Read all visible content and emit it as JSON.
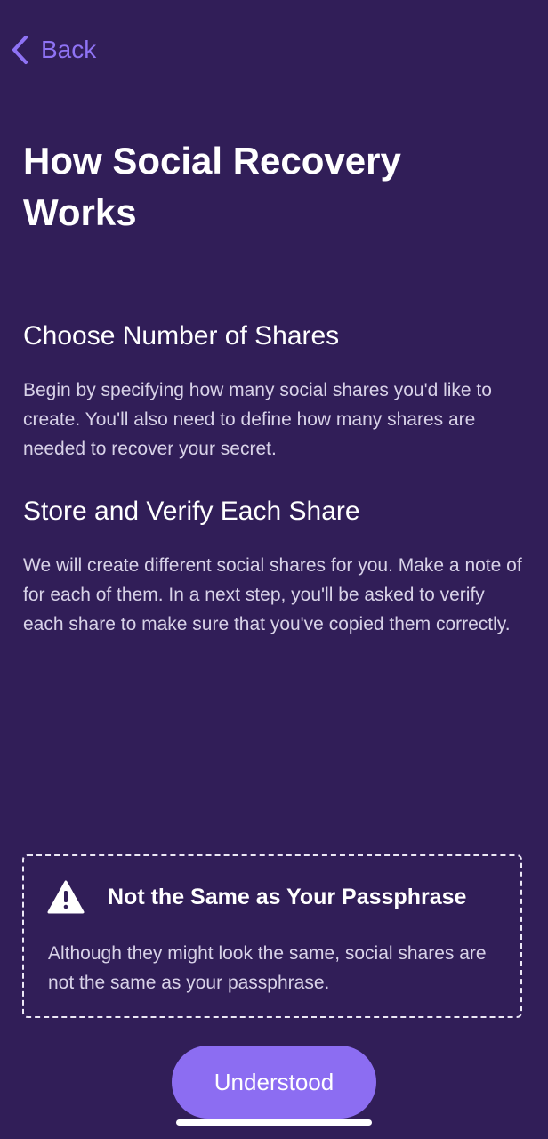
{
  "nav": {
    "back_label": "Back"
  },
  "page": {
    "title": "How Social Recovery Works"
  },
  "sections": [
    {
      "heading": "Choose Number of Shares",
      "body": "Begin by specifying how many social shares you'd like to create. You'll also need to define how many shares are needed to recover your secret."
    },
    {
      "heading": "Store and Verify Each Share",
      "body": "We will create different social shares for you. Make a note of for each of them. In a next step, you'll be asked to verify each share to make sure that you've copied them correctly."
    }
  ],
  "warning": {
    "icon": "warning-triangle-icon",
    "title": "Not the Same as Your Passphrase",
    "body": "Although they might look the same, social shares are not the same as your passphrase."
  },
  "actions": {
    "primary_label": "Understood"
  },
  "colors": {
    "background": "#311e58",
    "accent": "#8c6df2",
    "back_link": "#8f73f5"
  }
}
